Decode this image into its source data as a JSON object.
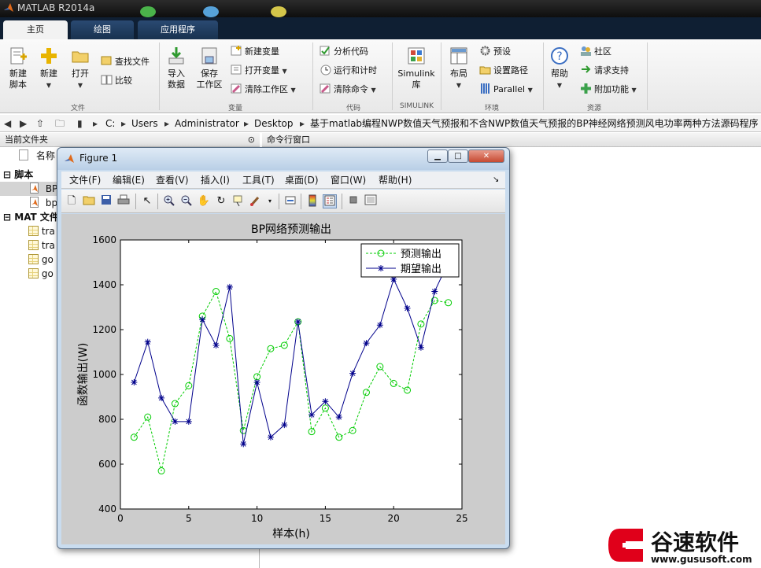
{
  "window": {
    "title": "MATLAB R2014a"
  },
  "tabs": [
    {
      "label": "主页"
    },
    {
      "label": "绘图"
    },
    {
      "label": "应用程序"
    }
  ],
  "ribbon": {
    "file": {
      "new_script": [
        "新建",
        "脚本"
      ],
      "new": "新建",
      "open": "打开",
      "find_files": "查找文件",
      "compare": "比较",
      "section": "文件"
    },
    "variable": {
      "import": [
        "导入",
        "数据"
      ],
      "save_workspace": [
        "保存",
        "工作区"
      ],
      "new_variable": "新建变量",
      "open_variable": "打开变量",
      "clear_workspace": "清除工作区",
      "section": "变量"
    },
    "code": {
      "analyze": "分析代码",
      "run_time": "运行和计时",
      "clear_commands": "清除命令",
      "section": "代码"
    },
    "simulink": {
      "label": [
        "Simulink",
        "库"
      ],
      "section": "SIMULINK"
    },
    "env": {
      "layout": "布局",
      "preferences": "预设",
      "set_path": "设置路径",
      "parallel": "Parallel",
      "section": "环境"
    },
    "resources": {
      "help": "帮助",
      "community": "社区",
      "support": "请求支持",
      "addons": "附加功能",
      "section": "资源"
    }
  },
  "address": {
    "path": [
      "C:",
      "Users",
      "Administrator",
      "Desktop",
      "基于matlab编程NWP数值天气预报和不含NWP数值天气预报的BP神经网络预测风电功率两种方法源码程序"
    ]
  },
  "left_panel": {
    "title": "当前文件夹",
    "column": "名称",
    "groups": [
      {
        "label": "脚本",
        "items": [
          "BP",
          "bp"
        ]
      },
      {
        "label": "MAT 文件",
        "items": [
          "tra",
          "tra",
          "go",
          "go"
        ]
      }
    ]
  },
  "right_panel": {
    "title": "命令行窗口"
  },
  "figure": {
    "title": "Figure 1",
    "menu": [
      "文件(F)",
      "编辑(E)",
      "查看(V)",
      "插入(I)",
      "工具(T)",
      "桌面(D)",
      "窗口(W)",
      "帮助(H)"
    ],
    "toolbar_icons": [
      "new-file-icon",
      "open-folder-icon",
      "save-icon",
      "print-icon",
      "pointer-icon",
      "zoom-in-icon",
      "zoom-out-icon",
      "pan-icon",
      "rotate-icon",
      "data-cursor-icon",
      "brush-icon",
      "link-icon",
      "colorbar-icon",
      "legend-icon",
      "hide-plot-tools-icon",
      "show-plot-tools-icon"
    ]
  },
  "chart_data": {
    "type": "line",
    "title": "BP网络预测输出",
    "xlabel": "样本(h)",
    "ylabel": "函数输出(W)",
    "xlim": [
      0,
      25
    ],
    "ylim": [
      400,
      1600
    ],
    "xticks": [
      0,
      5,
      10,
      15,
      20,
      25
    ],
    "yticks": [
      400,
      600,
      800,
      1000,
      1200,
      1400,
      1600
    ],
    "legend_position": "top-right",
    "x": [
      1,
      2,
      3,
      4,
      5,
      6,
      7,
      8,
      9,
      10,
      11,
      12,
      13,
      14,
      15,
      16,
      17,
      18,
      19,
      20,
      21,
      22,
      23,
      24
    ],
    "series": [
      {
        "name": "预测输出",
        "color": "#00cc00",
        "style": "dashed",
        "marker": "circle",
        "values": [
          720,
          810,
          570,
          870,
          950,
          1260,
          1370,
          1160,
          750,
          990,
          1115,
          1130,
          1235,
          745,
          850,
          720,
          750,
          920,
          1035,
          960,
          930,
          1225,
          1330,
          1320
        ]
      },
      {
        "name": "期望输出",
        "color": "#00008b",
        "style": "solid",
        "marker": "star",
        "values": [
          965,
          1145,
          895,
          790,
          790,
          1245,
          1130,
          1390,
          690,
          965,
          720,
          775,
          1235,
          820,
          880,
          810,
          1005,
          1140,
          1220,
          1425,
          1295,
          1120,
          1370,
          1500
        ]
      }
    ]
  },
  "watermark": {
    "brand": "谷速软件",
    "url": "www.gususoft.com",
    "accent": "#e0001a"
  }
}
